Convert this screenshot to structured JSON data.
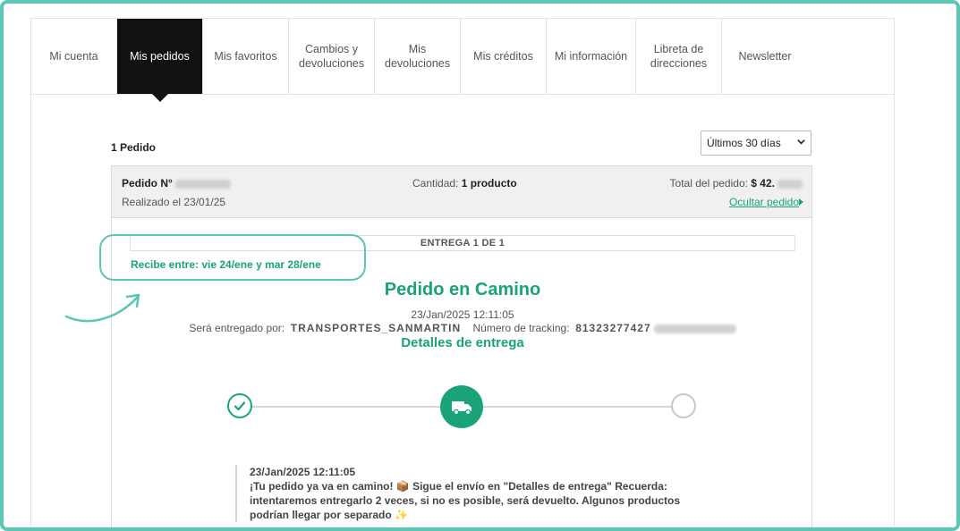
{
  "tabs": [
    {
      "label": "Mi cuenta"
    },
    {
      "label": "Mis pedidos"
    },
    {
      "label": "Mis favoritos"
    },
    {
      "label": "Cambios y devoluciones"
    },
    {
      "label": "Mis devoluciones"
    },
    {
      "label": "Mis créditos"
    },
    {
      "label": "Mi información"
    },
    {
      "label": "Libreta de direcciones"
    },
    {
      "label": "Newsletter"
    }
  ],
  "orders": {
    "count_label": "1 Pedido",
    "filter_value": "Últimos 30 días"
  },
  "order": {
    "number_label": "Pedido N°",
    "placed_label": "Realizado el 23/01/25",
    "quantity_label": "Cantidad:",
    "quantity_value": "1 producto",
    "total_label": "Total del pedido:",
    "total_value": "$ 42.",
    "hide_label": "Ocultar pedido"
  },
  "delivery": {
    "header": "ENTREGA 1 DE 1",
    "window": "Recibe entre: vie 24/ene y mar 28/ene",
    "status": "Pedido en Camino",
    "timestamp": "23/Jan/2025 12:11:05",
    "carrier_label": "Será entregado por:",
    "carrier": "TRANSPORTES_SANMARTIN",
    "tracking_label": "Número de tracking:",
    "tracking_value": "81323277427",
    "details_title": "Detalles de entrega"
  },
  "message": {
    "date": "23/Jan/2025 12:11:05",
    "text": "¡Tu pedido ya va en camino! 📦 Sigue el envío en \"Detalles de entrega\" Recuerda: intentaremos entregarlo 2 veces, si no es posible, será devuelto. Algunos productos podrían llegar por separado ✨"
  },
  "colors": {
    "accent": "#1aa37a",
    "frame": "#5ec6b4",
    "active_tab": "#111111"
  }
}
